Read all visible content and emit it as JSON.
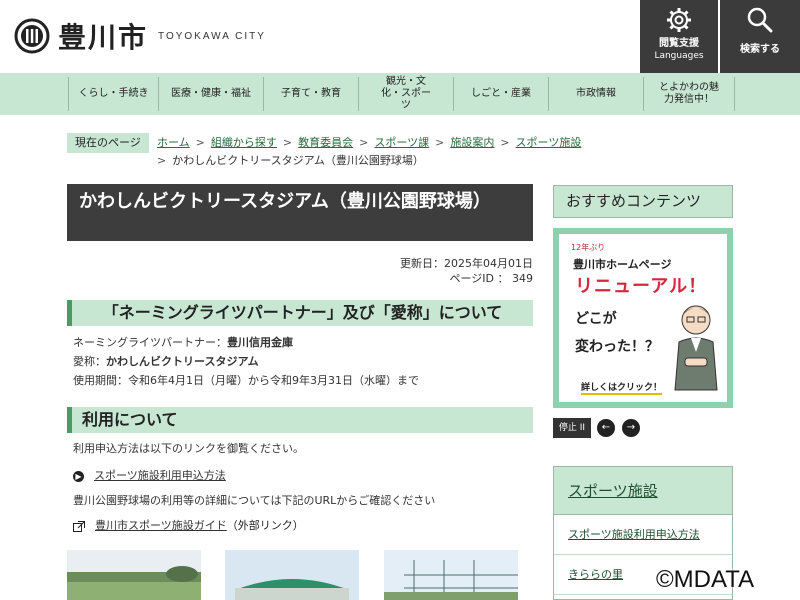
{
  "header": {
    "logo_text": "豊川市",
    "logo_en": "TOYOKAWA CITY",
    "lang_label": "閲覧支援",
    "lang_sub": "Languages",
    "search_label": "検索する"
  },
  "nav": {
    "items": [
      {
        "label": "くらし・手続き"
      },
      {
        "label": "医療・健康・福祉"
      },
      {
        "label": "子育て・教育"
      },
      {
        "label": "観光・文化・スポーツ"
      },
      {
        "label": "しごと・産業"
      },
      {
        "label": "市政情報"
      },
      {
        "label": "とよかわの魅力発信中！"
      }
    ]
  },
  "breadcrumb": {
    "label": "現在のページ",
    "links": [
      "ホーム",
      "組織から探す",
      "教育委員会",
      "スポーツ課",
      "施設案内",
      "スポーツ施設"
    ],
    "current": "かわしんビクトリースタジアム（豊川公園野球場）"
  },
  "main": {
    "title": "かわしんビクトリースタジアム（豊川公園野球場）",
    "updated": "更新日：2025年04月01日",
    "page_id": "ページID ： 349",
    "section1": {
      "heading": "「ネーミングライツパートナー」及び「愛称」について",
      "partner_label": "ネーミングライツパートナー：",
      "partner_value": "豊川信用金庫",
      "nickname_label": "愛称：",
      "nickname_value": "かわしんビクトリースタジアム",
      "period": "使用期間：令和6年4月1日（月曜）から令和9年3月31日（水曜）まで"
    },
    "section2": {
      "heading": "利用について",
      "intro": "利用申込方法は以下のリンクを御覧ください。",
      "link1": "スポーツ施設利用申込方法",
      "detail": "豊川公園野球場の利用等の詳細については下記のURLからご確認ください",
      "link2": "豊川市スポーツ施設ガイド",
      "link2_suffix": "（外部リンク）"
    }
  },
  "sidebar": {
    "recommend_heading": "おすすめコンテンツ",
    "banner": {
      "small": "12年ぶり",
      "line1": "豊川市ホームページ",
      "line2": "リニューアル！",
      "line3": "どこが",
      "line4": "変わった！？",
      "line5": "詳しくはクリック！"
    },
    "pause_label": "停止 II",
    "prev_icon": "arrow-left-icon",
    "next_icon": "arrow-right-icon",
    "sports_heading": "スポーツ施設",
    "sports_items": [
      "スポーツ施設利用申込方法",
      "きららの里"
    ]
  },
  "watermark": "©MDATA",
  "colors": {
    "accent_green": "#c8e7d3",
    "dark": "#3d3d3d",
    "banner_red": "#d7263d"
  }
}
